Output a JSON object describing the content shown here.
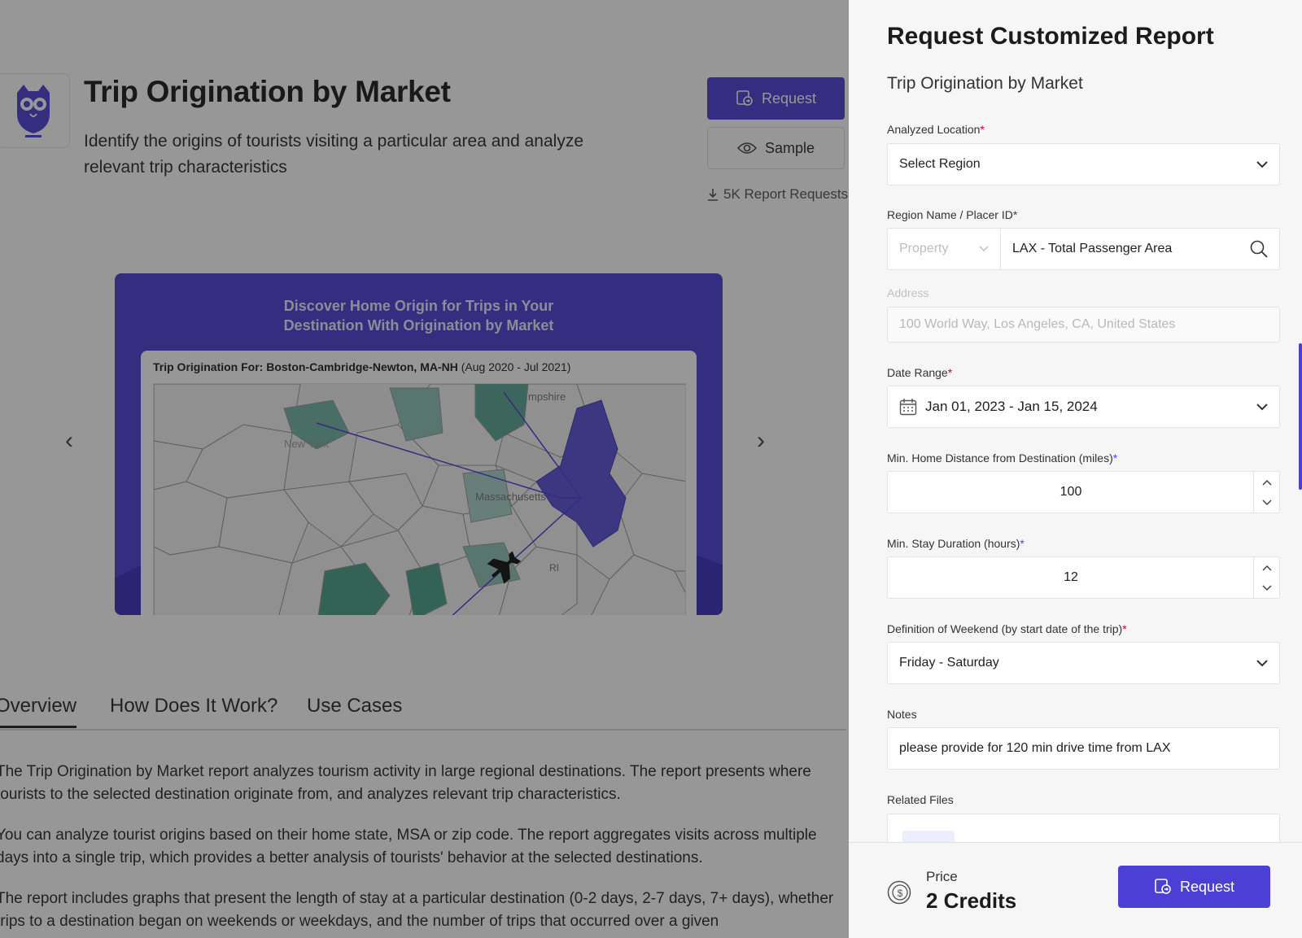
{
  "background": {
    "title": "Trip Origination by Market",
    "description": "Identify the origins of tourists visiting a particular area and analyze relevant trip characteristics",
    "request_label": "Request",
    "sample_label": "Sample",
    "report_requests": "5K Report Requests",
    "promo": {
      "heading_line1": "Discover Home Origin for Trips in Your",
      "heading_line2": "Destination With Origination by Market",
      "caption_bold": "Trip Origination For: Boston-Cambridge-Newton, MA-NH",
      "caption_range": "(Aug 2020 - Jul 2021)",
      "map_labels": [
        "mpshire",
        "New York",
        "Massachusetts",
        "RI"
      ]
    },
    "tabs": [
      "Overview",
      "How Does It Work?",
      "Use Cases"
    ],
    "paragraphs": [
      "The Trip Origination by Market report analyzes tourism activity in large regional destinations. The report presents where tourists to the selected destination originate from, and analyzes relevant trip characteristics.",
      "You can analyze tourist origins based on their home state, MSA or zip code. The report aggregates visits across multiple days into a single trip, which provides a better analysis of tourists' behavior at the selected destinations.",
      "The report includes graphs that present the length of stay at a particular destination (0-2 days, 2-7 days, 7+ days), whether trips to a destination began on weekends or weekdays, and the number of trips that occurred over a given"
    ]
  },
  "panel": {
    "title": "Request Customized Report",
    "subtitle": "Trip Origination by Market",
    "analyzed_location": {
      "label": "Analyzed Location",
      "value": "Select Region"
    },
    "region_name": {
      "label": "Region Name / Placer ID",
      "type_placeholder": "Property",
      "value": "LAX - Total Passenger Area"
    },
    "address": {
      "label": "Address",
      "value": "100 World Way, Los Angeles, CA, United States"
    },
    "date_range": {
      "label": "Date Range",
      "value": "Jan 01, 2023 - Jan 15, 2024"
    },
    "min_distance": {
      "label": "Min. Home Distance from Destination (miles)",
      "value": "100"
    },
    "min_stay": {
      "label": "Min. Stay Duration (hours)",
      "value": "12"
    },
    "weekend": {
      "label": "Definition of Weekend (by start date of the trip)",
      "value": "Friday - Saturday"
    },
    "notes": {
      "label": "Notes",
      "value": "please provide for 120 min drive time from LAX"
    },
    "related_files": {
      "label": "Related Files"
    },
    "price": {
      "label": "Price",
      "value": "2 Credits"
    },
    "request_label": "Request",
    "required_mark": "*"
  },
  "colors": {
    "accent": "#4b3fd6",
    "required": "#d0021b"
  }
}
